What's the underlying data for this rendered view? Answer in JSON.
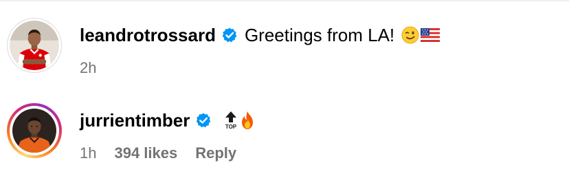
{
  "comments": [
    {
      "username": "leandrotrossard",
      "verified": true,
      "text": "Greetings from LA!",
      "emojis": [
        "winking-face-emoji",
        "us-flag-emoji"
      ],
      "time": "2h",
      "avatar_ring": "none"
    },
    {
      "username": "jurrientimber",
      "verified": true,
      "text": "",
      "emojis": [
        "top-arrow-emoji",
        "fire-emoji"
      ],
      "top_label": "TOP",
      "time": "1h",
      "likes": "394 likes",
      "reply": "Reply",
      "avatar_ring": "story-gradient"
    }
  ],
  "colors": {
    "verified_blue": "#0095f6",
    "meta_gray": "#737373",
    "arsenal_red": "#db0007"
  }
}
